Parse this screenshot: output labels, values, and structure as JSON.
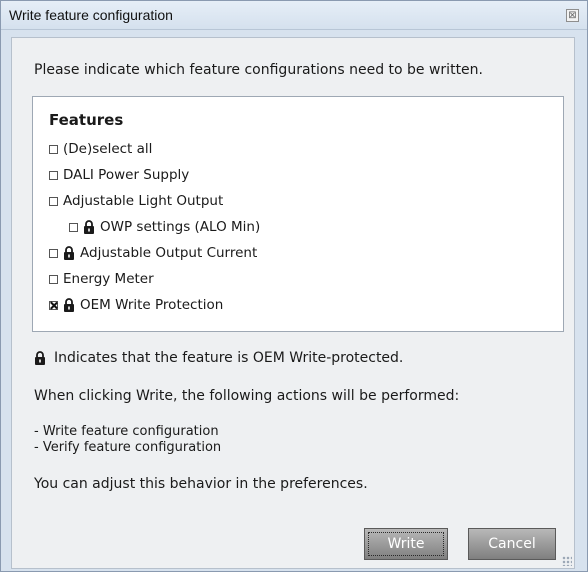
{
  "window": {
    "title": "Write feature configuration",
    "close_glyph": "⊠"
  },
  "intro_text": "Please indicate which feature configurations need to be written.",
  "features": {
    "heading": "Features",
    "items": [
      {
        "label": "(De)select all",
        "checked": false,
        "locked": false,
        "indent": 0
      },
      {
        "label": "DALI Power Supply",
        "checked": false,
        "locked": false,
        "indent": 0
      },
      {
        "label": "Adjustable Light Output",
        "checked": false,
        "locked": false,
        "indent": 0
      },
      {
        "label": "OWP settings (ALO Min)",
        "checked": false,
        "locked": true,
        "indent": 1
      },
      {
        "label": "Adjustable Output Current",
        "checked": false,
        "locked": true,
        "indent": 0
      },
      {
        "label": "Energy Meter",
        "checked": false,
        "locked": false,
        "indent": 0
      },
      {
        "label": "OEM Write Protection",
        "checked": true,
        "locked": true,
        "indent": 0
      }
    ]
  },
  "legend_text": "Indicates that the feature is OEM Write-protected.",
  "actions_intro": "When clicking Write, the following actions will be performed:",
  "actions": [
    "- Write feature configuration",
    "- Verify feature configuration"
  ],
  "preferences_note": "You can adjust this behavior in the preferences.",
  "buttons": {
    "write": "Write",
    "cancel": "Cancel"
  },
  "icons": {
    "lock": "lock-icon",
    "close": "close-icon"
  },
  "colors": {
    "dialog_bg": "#d7e2ee",
    "panel_bg": "#eef0f2",
    "button_gray": "#8e8e8e"
  }
}
